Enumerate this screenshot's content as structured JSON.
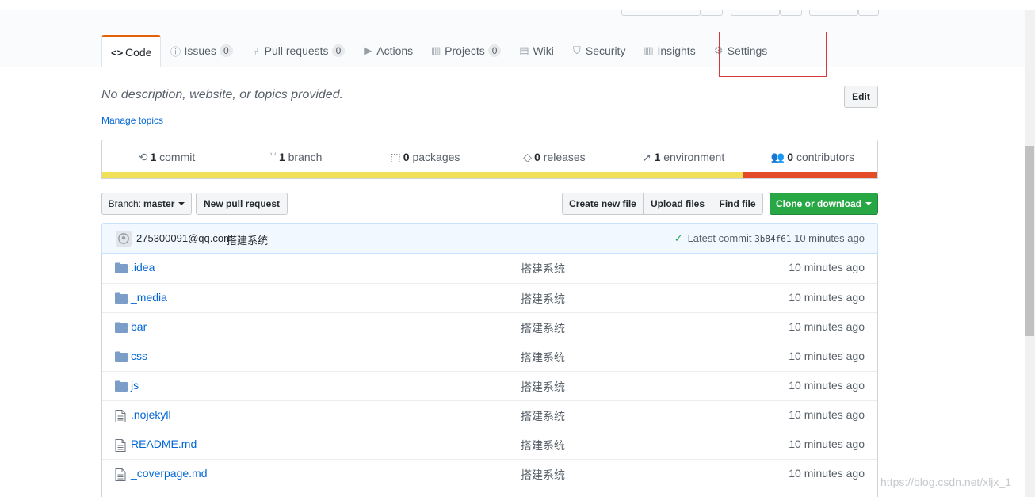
{
  "tabs": [
    {
      "icon": "code-icon",
      "glyph": "<>",
      "label": "Code",
      "selected": true
    },
    {
      "icon": "issue-icon",
      "glyph": "ⓘ",
      "label": "Issues",
      "count": "0"
    },
    {
      "icon": "pull-request-icon",
      "glyph": "⑂",
      "label": "Pull requests",
      "count": "0"
    },
    {
      "icon": "play-icon",
      "glyph": "▶",
      "label": "Actions"
    },
    {
      "icon": "project-icon",
      "glyph": "▥",
      "label": "Projects",
      "count": "0"
    },
    {
      "icon": "book-icon",
      "glyph": "▤",
      "label": "Wiki"
    },
    {
      "icon": "shield-icon",
      "glyph": "⛉",
      "label": "Security"
    },
    {
      "icon": "graph-icon",
      "glyph": "▥",
      "label": "Insights"
    },
    {
      "icon": "gear-icon",
      "glyph": "⚙",
      "label": "Settings"
    }
  ],
  "repo": {
    "description": "No description, website, or topics provided.",
    "edit_label": "Edit",
    "manage_topics": "Manage topics"
  },
  "summary": [
    {
      "icon": "history-icon",
      "glyph": "⟲",
      "count": "1",
      "label": "commit"
    },
    {
      "icon": "branch-icon",
      "glyph": "ᛘ",
      "count": "1",
      "label": "branch"
    },
    {
      "icon": "package-icon",
      "glyph": "⬚",
      "count": "0",
      "label": "packages"
    },
    {
      "icon": "tag-icon",
      "glyph": "◇",
      "count": "0",
      "label": "releases"
    },
    {
      "icon": "rocket-icon",
      "glyph": "➚",
      "count": "1",
      "label": "environment"
    },
    {
      "icon": "people-icon",
      "glyph": "👥",
      "count": "0",
      "label": "contributors"
    }
  ],
  "language_bar": [
    {
      "color": "#f1e05a",
      "fraction": 0.826
    },
    {
      "color": "#e34c26",
      "fraction": 0.174
    }
  ],
  "toolbar": {
    "branch_prefix": "Branch:",
    "branch_name": "master",
    "new_pull_request": "New pull request",
    "create_new_file": "Create new file",
    "upload_files": "Upload files",
    "find_file": "Find file",
    "clone_or_download": "Clone or download"
  },
  "latest_commit": {
    "author": "275300091@qq.com",
    "message": "搭建系统",
    "prefix": "Latest commit",
    "sha": "3b84f61",
    "age": "10 minutes ago"
  },
  "files": [
    {
      "type": "dir",
      "name": ".idea",
      "message": "搭建系统",
      "age": "10 minutes ago"
    },
    {
      "type": "dir",
      "name": "_media",
      "message": "搭建系统",
      "age": "10 minutes ago"
    },
    {
      "type": "dir",
      "name": "bar",
      "message": "搭建系统",
      "age": "10 minutes ago"
    },
    {
      "type": "dir",
      "name": "css",
      "message": "搭建系统",
      "age": "10 minutes ago"
    },
    {
      "type": "dir",
      "name": "js",
      "message": "搭建系统",
      "age": "10 minutes ago"
    },
    {
      "type": "file",
      "name": ".nojekyll",
      "message": "搭建系统",
      "age": "10 minutes ago"
    },
    {
      "type": "file",
      "name": "README.md",
      "message": "搭建系统",
      "age": "10 minutes ago"
    },
    {
      "type": "file",
      "name": "_coverpage.md",
      "message": "搭建系统",
      "age": "10 minutes ago"
    }
  ],
  "watermark": "https://blog.csdn.net/xljx_1",
  "colors": {
    "accent_tab": "#e36209",
    "link": "#0366d6",
    "green": "#28a745",
    "highlight_box": "#d9383a"
  }
}
